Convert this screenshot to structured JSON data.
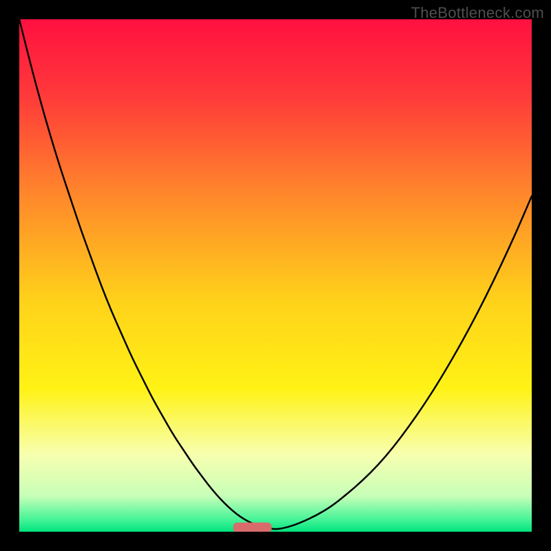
{
  "watermark": "TheBottleneck.com",
  "chart_data": {
    "type": "line",
    "title": "",
    "xlabel": "",
    "ylabel": "",
    "xlim": [
      0,
      100
    ],
    "ylim": [
      0,
      100
    ],
    "grid": false,
    "legend": false,
    "background_gradient": {
      "type": "vertical",
      "stops": [
        {
          "pos": 0.0,
          "color": "#ff1040"
        },
        {
          "pos": 0.15,
          "color": "#ff3a3a"
        },
        {
          "pos": 0.35,
          "color": "#ff8a2a"
        },
        {
          "pos": 0.55,
          "color": "#ffd21a"
        },
        {
          "pos": 0.72,
          "color": "#fff215"
        },
        {
          "pos": 0.85,
          "color": "#f7ffb0"
        },
        {
          "pos": 0.93,
          "color": "#c8ffb8"
        },
        {
          "pos": 0.98,
          "color": "#3bf294"
        },
        {
          "pos": 1.0,
          "color": "#00e37e"
        }
      ]
    },
    "series": [
      {
        "name": "curve",
        "color": "#000000",
        "width": 2.5,
        "x": [
          0,
          2,
          4,
          6,
          8,
          10,
          12,
          14,
          16,
          18,
          20,
          22,
          24,
          26,
          28,
          30,
          32,
          34,
          35.5,
          37,
          38.5,
          40,
          41.5,
          43,
          45,
          47.5,
          50,
          52.5,
          55,
          58,
          61,
          64,
          67,
          70,
          73,
          76,
          79,
          82,
          85,
          88,
          91,
          94,
          97,
          100
        ],
        "y": [
          100,
          92,
          84.5,
          77.5,
          71,
          65,
          59,
          53.5,
          48,
          43,
          38.5,
          34,
          30,
          26,
          22.5,
          19,
          16,
          13,
          11,
          9,
          7.2,
          5.6,
          4.2,
          3.0,
          1.8,
          0.9,
          0.4,
          0.9,
          1.8,
          3.2,
          5.0,
          7.4,
          10.0,
          13.0,
          16.5,
          20.5,
          24.8,
          29.5,
          34.6,
          40.0,
          45.8,
          52.0,
          58.5,
          65.5
        ]
      }
    ],
    "marker": {
      "name": "min-marker",
      "shape": "rounded-rect",
      "center_x": 45.5,
      "width": 7.5,
      "y": 0.8,
      "height": 2.0,
      "color": "#d86b6b"
    }
  }
}
